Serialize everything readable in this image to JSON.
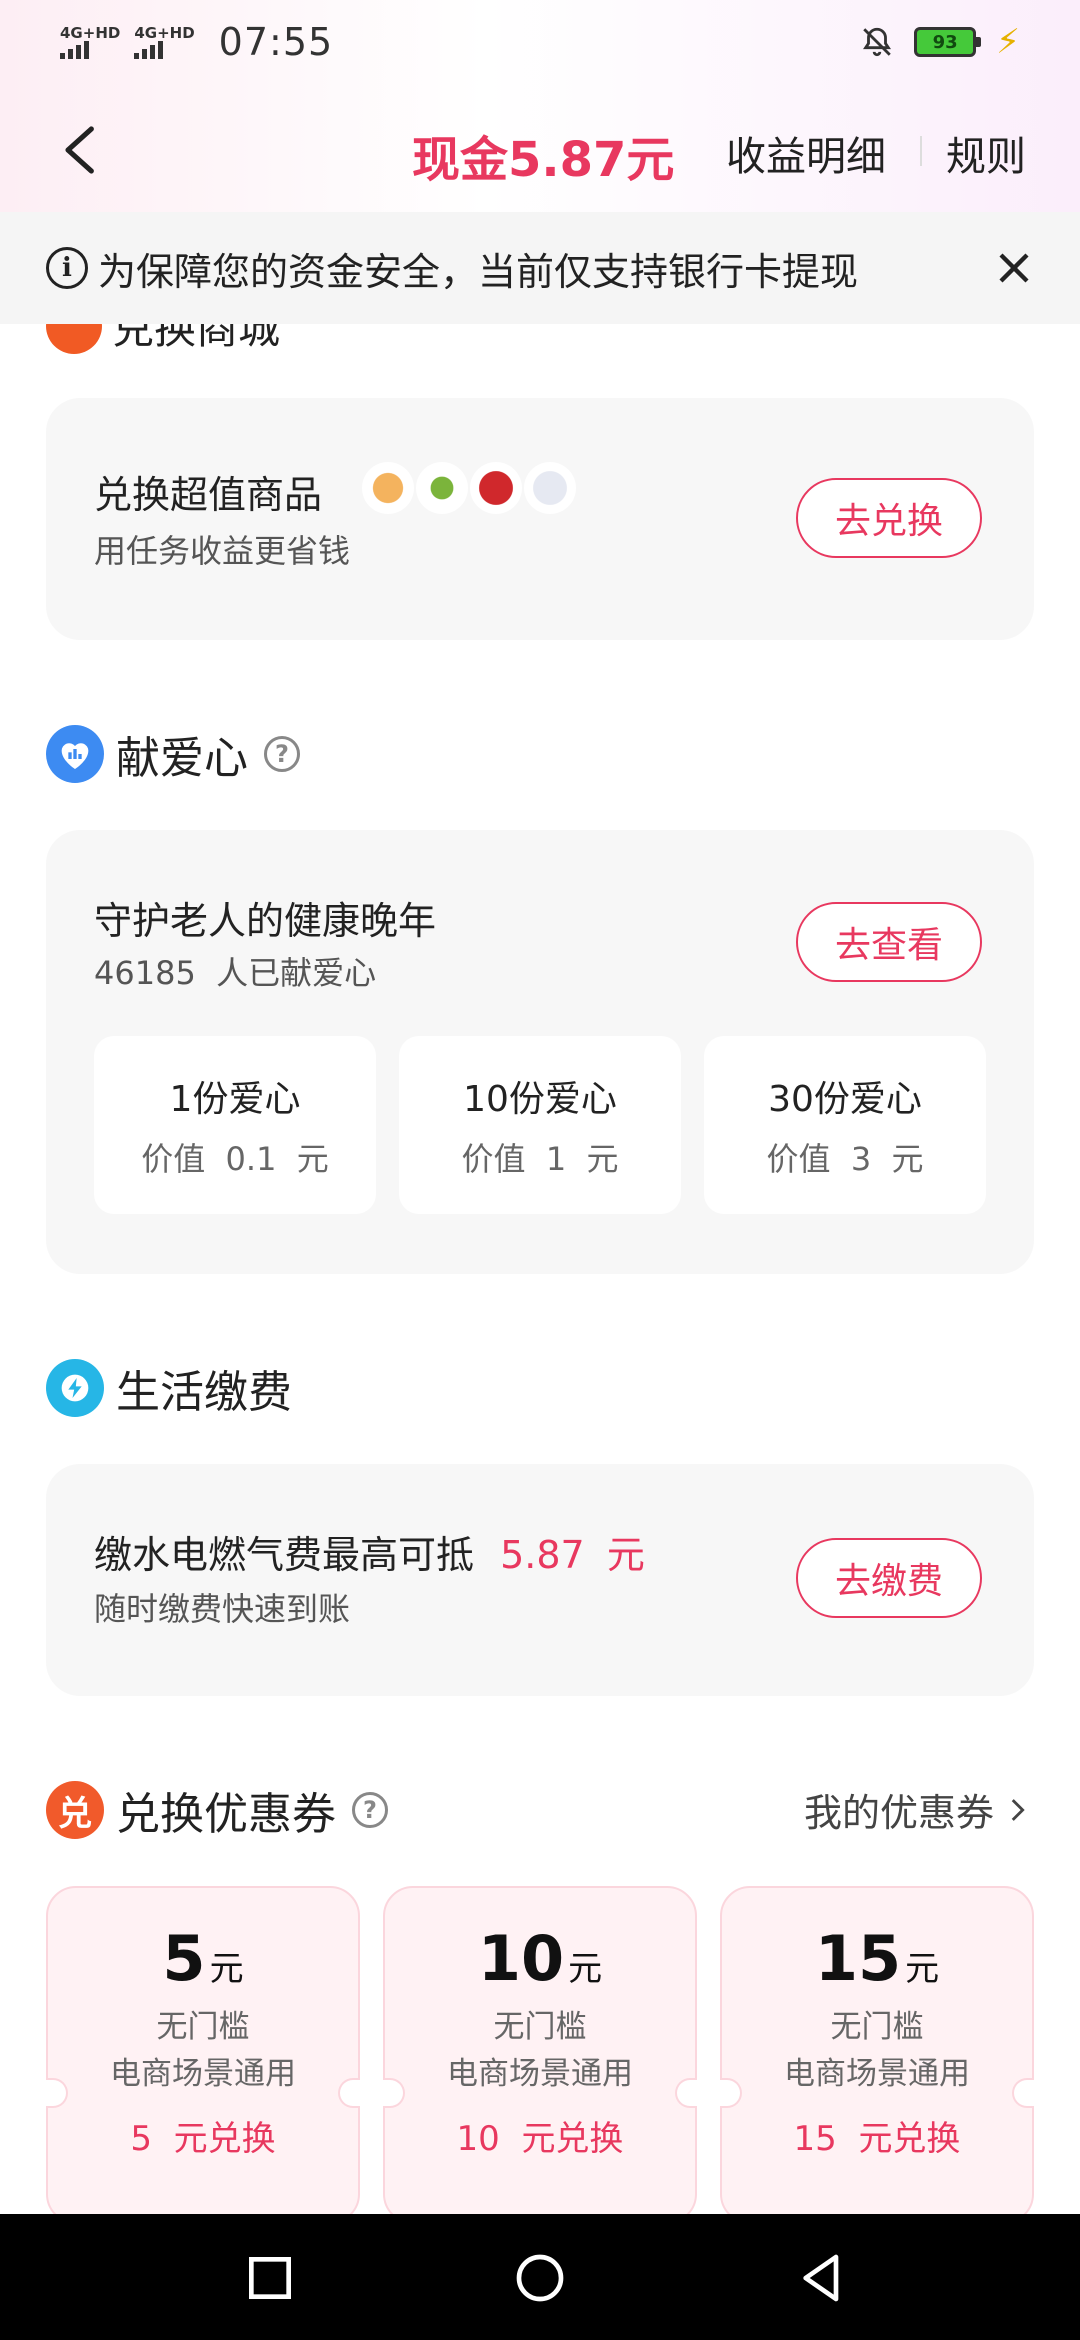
{
  "status_bar": {
    "network_1": "4G+HD",
    "network_2": "4G+HD",
    "time": "07:55",
    "battery": "93",
    "icons": [
      "silent-bell-icon",
      "battery-icon",
      "charging-bolt-icon"
    ]
  },
  "nav": {
    "cash_label": "现金5.87元",
    "detail_label": "收益明细",
    "rules_label": "规则"
  },
  "notice": {
    "text": "为保障您的资金安全，当前仅支持银行卡提现"
  },
  "mall": {
    "section_title": "兑换商城",
    "card_title": "兑换超值商品",
    "card_sub": "用任务收益更省钱",
    "button": "去兑换"
  },
  "charity": {
    "section_title": "献爱心",
    "help": "?",
    "card_title": "守护老人的健康晚年",
    "count": "46185",
    "count_suffix": "人已献爱心",
    "button": "去查看",
    "options": [
      {
        "title": "1份爱心",
        "value_prefix": "价值",
        "value": "0.1",
        "unit": "元"
      },
      {
        "title": "10份爱心",
        "value_prefix": "价值",
        "value": "1",
        "unit": "元"
      },
      {
        "title": "30份爱心",
        "value_prefix": "价值",
        "value": "3",
        "unit": "元"
      }
    ]
  },
  "utilities": {
    "section_title": "生活缴费",
    "card_title": "缴水电燃气费最高可抵",
    "amount": "5.87",
    "unit": "元",
    "card_sub": "随时缴费快速到账",
    "button": "去缴费"
  },
  "coupons": {
    "section_title": "兑换优惠券",
    "help": "?",
    "my_coupons": "我的优惠券",
    "items": [
      {
        "amount": "5",
        "unit": "元",
        "line1": "无门槛",
        "line2": "电商场景通用",
        "exchange_amount": "5",
        "exchange_suffix": "元兑换"
      },
      {
        "amount": "10",
        "unit": "元",
        "line1": "无门槛",
        "line2": "电商场景通用",
        "exchange_amount": "10",
        "exchange_suffix": "元兑换"
      },
      {
        "amount": "15",
        "unit": "元",
        "line1": "无门槛",
        "line2": "电商场景通用",
        "exchange_amount": "15",
        "exchange_suffix": "元兑换"
      }
    ]
  },
  "colors": {
    "accent": "#e8385f",
    "card_bg": "#f7f7f7",
    "notice_bg": "#f5f5f5"
  }
}
